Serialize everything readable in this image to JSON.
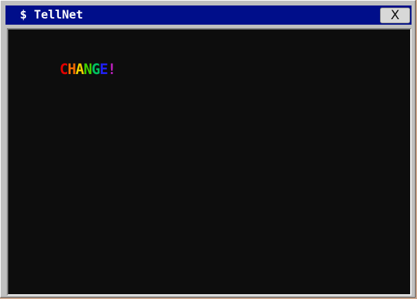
{
  "window": {
    "title": "$ TellNet",
    "close_label": "X"
  },
  "terminal": {
    "lines": [
      {
        "segments": [
          {
            "text": "C",
            "color": "#e00000"
          },
          {
            "text": "H",
            "color": "#f06a00"
          },
          {
            "text": "A",
            "color": "#f0d000"
          },
          {
            "text": "N",
            "color": "#40d000"
          },
          {
            "text": "G",
            "color": "#00c060"
          },
          {
            "text": "E",
            "color": "#2020f0"
          },
          {
            "text": "!",
            "color": "#c020c0"
          }
        ]
      }
    ]
  },
  "colors": {
    "titlebar": "#000e8a",
    "terminal_background": "#0d0d0d",
    "window_frame": "#c0c0c0"
  }
}
